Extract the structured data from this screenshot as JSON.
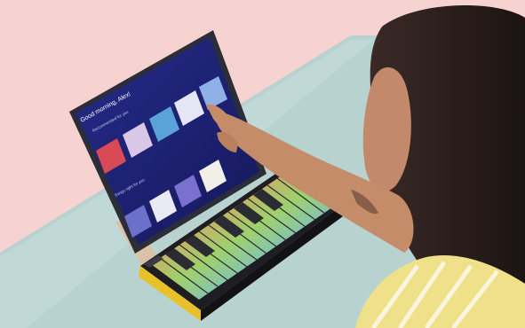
{
  "scene": {
    "description_colors": {
      "wall_pink": "#f6d2d0",
      "table_teal": "#b9d2d0",
      "tablet_bezel": "#2c2e3a",
      "screen_bg": "#1a1e6e",
      "keyboard_body": "#1e1e22",
      "keyboard_side_yellow": "#e9c227",
      "skin": "#c58c6a",
      "hair": "#2a1e1c",
      "shirt_yellow": "#efe08a"
    }
  },
  "tablet_screen": {
    "greeting": "Good morning, Alex!",
    "section_1": "Recommended for you",
    "section_2": "Songs right for you"
  }
}
